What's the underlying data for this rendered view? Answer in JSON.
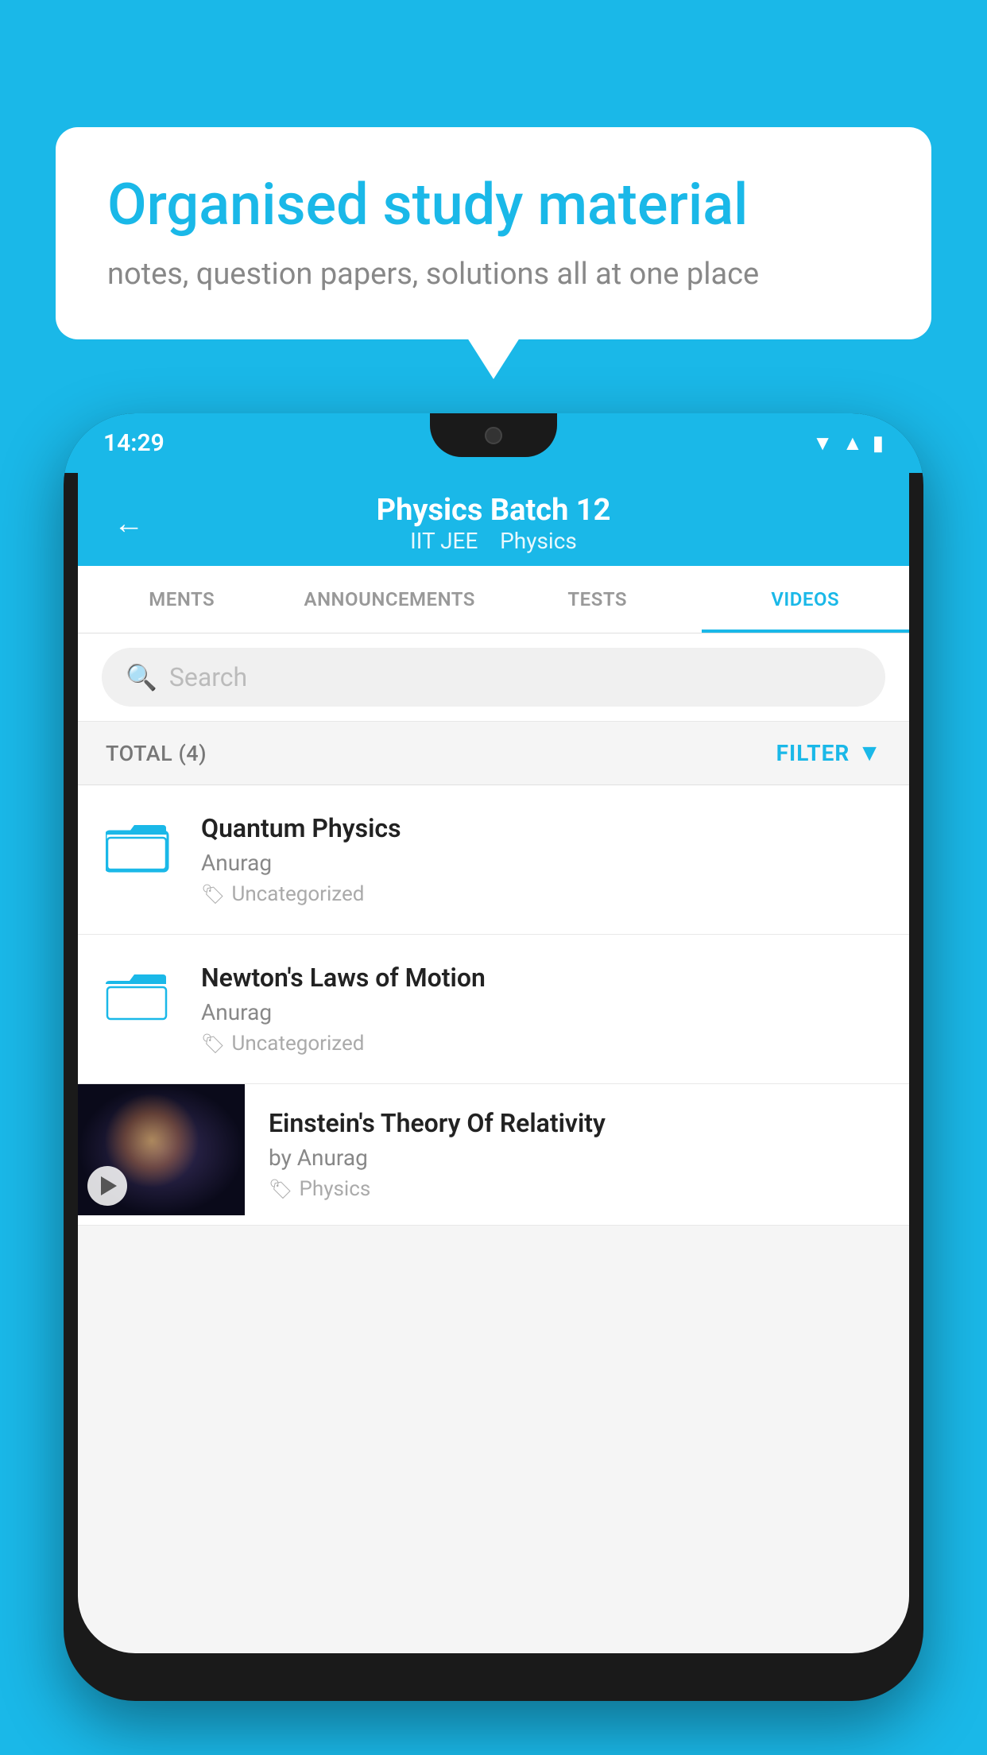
{
  "background_color": "#1ab8e8",
  "speech_bubble": {
    "title": "Organised study material",
    "subtitle": "notes, question papers, solutions all at one place"
  },
  "phone": {
    "status_bar": {
      "time": "14:29",
      "icons": [
        "wifi",
        "signal",
        "battery"
      ]
    },
    "header": {
      "back_label": "←",
      "title": "Physics Batch 12",
      "subtitle_tags": [
        "IIT JEE",
        "Physics"
      ]
    },
    "tabs": [
      {
        "label": "MENTS",
        "active": false
      },
      {
        "label": "ANNOUNCEMENTS",
        "active": false
      },
      {
        "label": "TESTS",
        "active": false
      },
      {
        "label": "VIDEOS",
        "active": true
      }
    ],
    "search": {
      "placeholder": "Search"
    },
    "filter_bar": {
      "total_label": "TOTAL (4)",
      "filter_label": "FILTER"
    },
    "videos": [
      {
        "id": 1,
        "title": "Quantum Physics",
        "author": "Anurag",
        "tag": "Uncategorized",
        "has_thumbnail": false
      },
      {
        "id": 2,
        "title": "Newton's Laws of Motion",
        "author": "Anurag",
        "tag": "Uncategorized",
        "has_thumbnail": false
      },
      {
        "id": 3,
        "title": "Einstein's Theory Of Relativity",
        "author": "by Anurag",
        "tag": "Physics",
        "has_thumbnail": true
      }
    ]
  }
}
